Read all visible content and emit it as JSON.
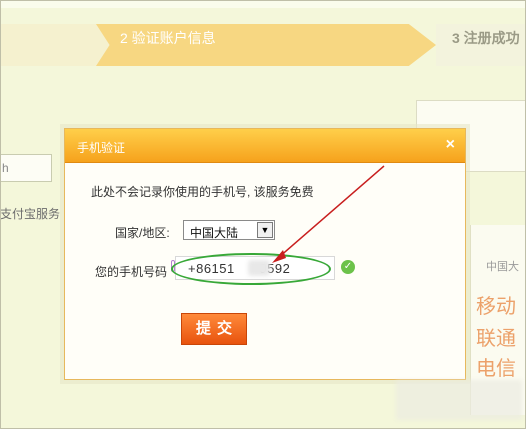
{
  "steps": {
    "step2": "2 验证账户信息",
    "step3": "3 注册成功"
  },
  "background": {
    "input_partial": "h",
    "alipay_partial": "支付宝服务",
    "right_country": "中国大",
    "right_lines": [
      "移动",
      "联通",
      "电信"
    ]
  },
  "dialog": {
    "title": "手机验证",
    "close": "×",
    "note": "此处不会记录你使用的手机号, 该服务免费",
    "country_label": "国家/地区:",
    "country_value": "中国大陆",
    "select_arrow": "▼",
    "phone_label": "您的手机号码",
    "phone_value": "+86151      9592",
    "valid_icon": "check-icon",
    "submit": "提交"
  },
  "colors": {
    "accent": "#f6a21c",
    "submit": "#e8530e",
    "annotation_ellipse": "#38a838",
    "annotation_arrow": "#c81e1e"
  }
}
